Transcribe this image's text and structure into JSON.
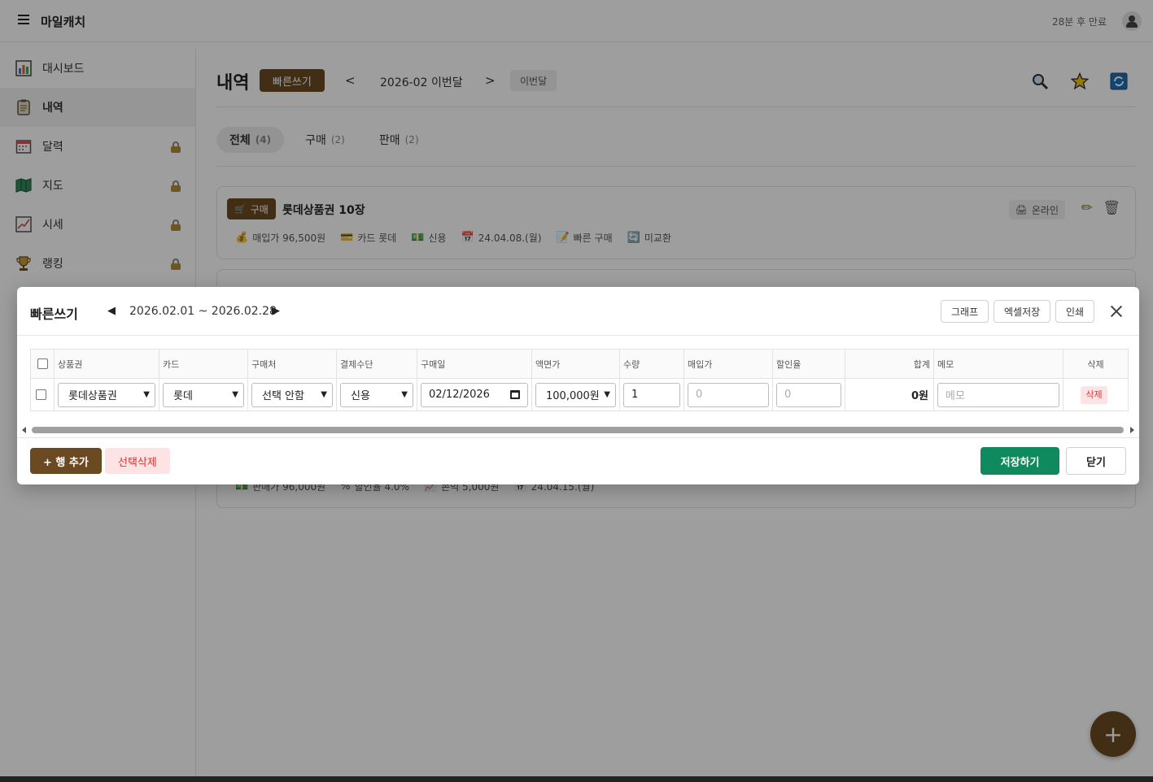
{
  "header": {
    "app_title": "마일캐치",
    "session_text": "28분 후 만료"
  },
  "sidebar": {
    "items": [
      {
        "label": "대시보드",
        "icon": "chart-icon",
        "locked": false,
        "active": false
      },
      {
        "label": "내역",
        "icon": "clipboard-icon",
        "locked": false,
        "active": true
      },
      {
        "label": "달력",
        "icon": "calendar-icon",
        "locked": true,
        "active": false
      },
      {
        "label": "지도",
        "icon": "map-icon",
        "locked": true,
        "active": false
      },
      {
        "label": "시세",
        "icon": "trend-icon",
        "locked": true,
        "active": false
      },
      {
        "label": "랭킹",
        "icon": "trophy-icon",
        "locked": true,
        "active": false
      }
    ]
  },
  "main": {
    "title": "내역",
    "quick_write_label": "빠른쓰기",
    "month_label": "2026-02 이번달",
    "this_month_label": "이번달",
    "tabs": [
      {
        "label": "전체",
        "count": "(4)"
      },
      {
        "label": "구매",
        "count": "(2)"
      },
      {
        "label": "판매",
        "count": "(2)"
      }
    ]
  },
  "cards": [
    {
      "badge": "구매",
      "title": "롯데상품권 10장",
      "online_label": "온라인",
      "meta": {
        "purchase_price": "매입가 96,500원",
        "card": "카드 롯데",
        "payment": "신용",
        "date": "24.04.08.(월)",
        "source": "빠른 구매",
        "status": "미교환"
      }
    },
    {
      "meta": {
        "sale_price": "판매가 96,000원",
        "discount": "할인율 4.0%",
        "profit": "손익 5,000원",
        "date": "24.04.15.(월)"
      }
    }
  ],
  "modal": {
    "title": "빠른쓰기",
    "range": "2026.02.01 ~ 2026.02.28",
    "graph_label": "그래프",
    "excel_label": "엑셀저장",
    "print_label": "인쇄",
    "columns": [
      "상품권",
      "카드",
      "구매처",
      "결제수단",
      "구매일",
      "액면가",
      "수량",
      "매입가",
      "할인율",
      "합계",
      "메모",
      "삭제"
    ],
    "row": {
      "voucher": "롯데상품권",
      "card": "롯데",
      "store": "선택 안함",
      "payment": "신용",
      "date": "02/12/2026",
      "face_value": "100,000원",
      "quantity": "1",
      "purchase_price_placeholder": "0",
      "discount_placeholder": "0",
      "total": "0원",
      "memo_placeholder": "메모",
      "delete_label": "삭제"
    },
    "add_row_label": "+ 행 추가",
    "delete_selected_label": "선택삭제",
    "save_label": "저장하기",
    "close_label": "닫기"
  },
  "colors": {
    "brand_brown": "#6b4a22",
    "save_green": "#0f8a5f",
    "danger_red": "#d33333"
  }
}
